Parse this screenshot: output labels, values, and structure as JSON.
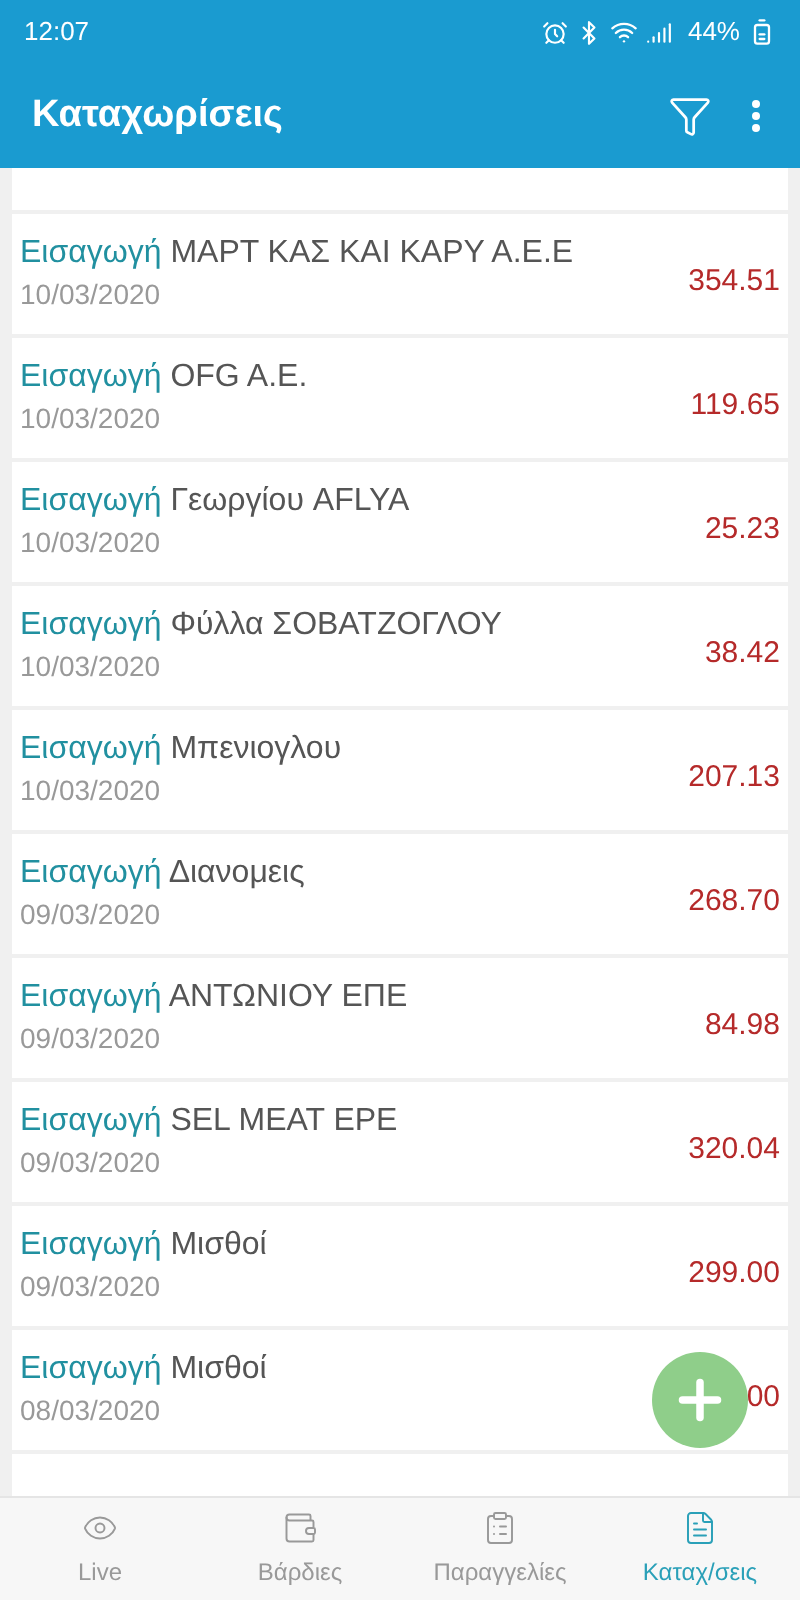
{
  "status_bar": {
    "time": "12:07",
    "battery": "44%"
  },
  "header": {
    "title": "Καταχωρίσεις"
  },
  "entries": [
    {
      "type": "Εισαγωγή",
      "name": "ΜΑΡΤ ΚΑΣ ΚΑΙ ΚΑΡΥ Α.Ε.Ε",
      "date": "10/03/2020",
      "amount": "354.51"
    },
    {
      "type": "Εισαγωγή",
      "name": "OFG A.E.",
      "date": "10/03/2020",
      "amount": "119.65"
    },
    {
      "type": "Εισαγωγή",
      "name": "Γεωργίου AFLYA",
      "date": "10/03/2020",
      "amount": "25.23"
    },
    {
      "type": "Εισαγωγή",
      "name": "Φύλλα ΣΟΒΑΤΖΟΓΛΟΥ",
      "date": "10/03/2020",
      "amount": "38.42"
    },
    {
      "type": "Εισαγωγή",
      "name": "Μπενιογλου",
      "date": "10/03/2020",
      "amount": "207.13"
    },
    {
      "type": "Εισαγωγή",
      "name": "Διανομεις",
      "date": "09/03/2020",
      "amount": "268.70"
    },
    {
      "type": "Εισαγωγή",
      "name": "ΑΝΤΩΝΙΟΥ ΕΠΕ",
      "date": "09/03/2020",
      "amount": "84.98"
    },
    {
      "type": "Εισαγωγή",
      "name": "SEL MEAT EPE",
      "date": "09/03/2020",
      "amount": "320.04"
    },
    {
      "type": "Εισαγωγή",
      "name": "Μισθοί",
      "date": "09/03/2020",
      "amount": "299.00"
    },
    {
      "type": "Εισαγωγή",
      "name": "Μισθοί",
      "date": "08/03/2020",
      "amount": "00"
    }
  ],
  "nav": [
    {
      "label": "Live",
      "selected": false
    },
    {
      "label": "Βάρδιες",
      "selected": false
    },
    {
      "label": "Παραγγελίες",
      "selected": false
    },
    {
      "label": "Καταχ/σεις",
      "selected": true
    }
  ]
}
